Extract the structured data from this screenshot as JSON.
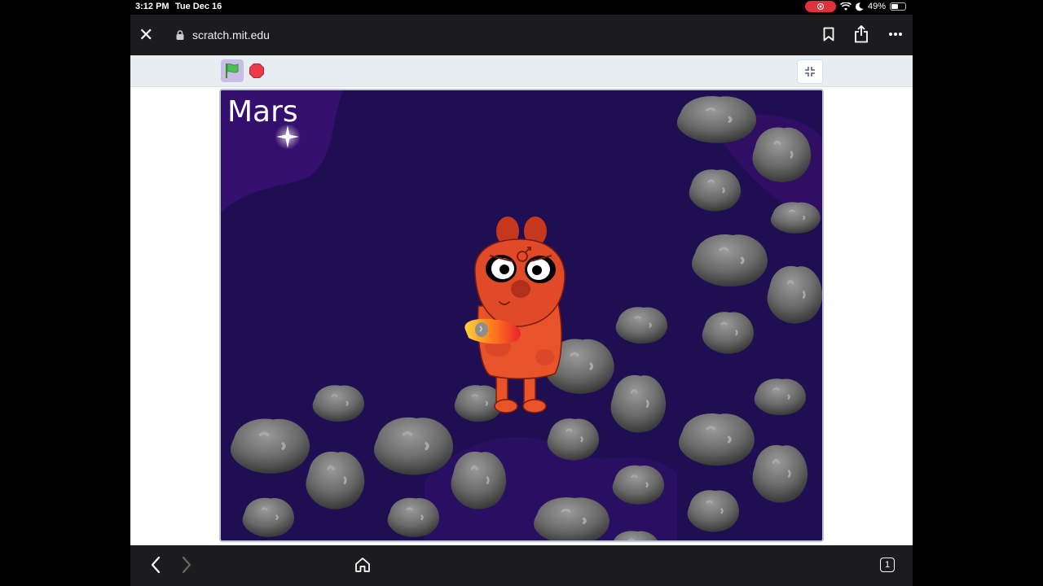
{
  "status": {
    "time": "3:12 PM",
    "date": "Tue Dec 16",
    "battery": "49%"
  },
  "browser": {
    "url": "scratch.mit.edu"
  },
  "project": {
    "stage_title": "Mars"
  },
  "icons": {
    "close": "close-icon",
    "lock": "lock-icon",
    "bookmark": "bookmark-icon",
    "share": "share-icon",
    "more": "more-icon",
    "flag": "green-flag-icon",
    "stop": "stop-icon",
    "fullscreen": "exit-fullscreen-icon",
    "back": "back-icon",
    "forward": "forward-icon",
    "home": "home-icon",
    "tabs": "tabs-icon"
  },
  "colors": {
    "stage_bg": "#1f0e52",
    "flag_bg": "#c9bde8",
    "stop": "#ec3b48",
    "mars": "#e8532a"
  },
  "tabs_count": "1"
}
